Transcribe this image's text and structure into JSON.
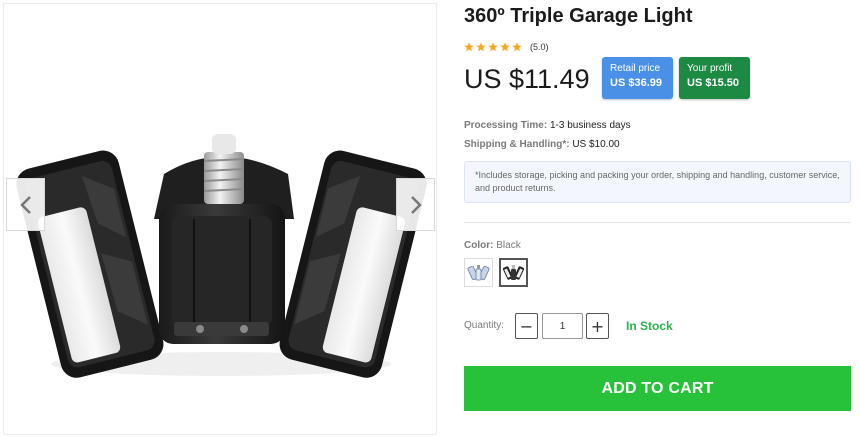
{
  "product": {
    "title": "360º Triple Garage Light",
    "rating": {
      "stars": 5,
      "score_text": "(5.0)"
    },
    "price": "US $11.49",
    "retail": {
      "label": "Retail price",
      "value": "US $36.99"
    },
    "profit": {
      "label": "Your profit",
      "value": "US $15.50"
    },
    "processing": {
      "label": "Processing Time:",
      "value": "1-3 business days"
    },
    "shipping": {
      "label": "Shipping & Handling*:",
      "value": "US $10.00"
    },
    "note": "*Includes storage, picking and packing your order, shipping and handling, customer service, and product returns.",
    "color": {
      "label": "Color:",
      "value": "Black",
      "options": [
        "White",
        "Black"
      ],
      "selected_index": 1
    },
    "quantity": {
      "label": "Quantity:",
      "value": "1",
      "minus": "−",
      "plus": "+"
    },
    "stock": "In Stock",
    "add_to_cart": "ADD TO CART"
  },
  "gallery": {
    "prev_icon": "chevron-left-icon",
    "next_icon": "chevron-right-icon"
  },
  "colors": {
    "star": "#f5a623",
    "retail_badge": "#4a90e6",
    "profit_badge": "#1c8a43",
    "in_stock": "#2bb24c",
    "add_to_cart": "#27c23a"
  }
}
